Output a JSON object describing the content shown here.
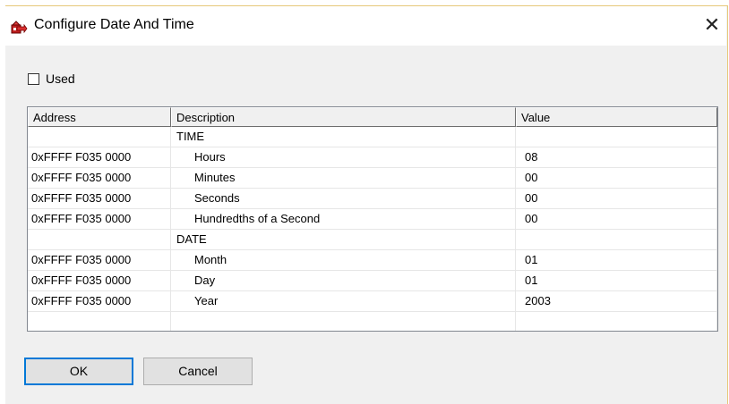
{
  "window": {
    "title": "Configure Date And Time",
    "close_glyph": "✕",
    "icon": "config-icon"
  },
  "used": {
    "label": "Used",
    "checked": false
  },
  "table": {
    "headers": [
      "Address",
      "Description",
      "Value"
    ],
    "rows": [
      {
        "address": "",
        "description": "TIME",
        "value": "",
        "indent": false
      },
      {
        "address": "0xFFFF F035 0000",
        "description": "Hours",
        "value": "08",
        "indent": true
      },
      {
        "address": "0xFFFF F035 0000",
        "description": "Minutes",
        "value": "00",
        "indent": true
      },
      {
        "address": "0xFFFF F035 0000",
        "description": "Seconds",
        "value": "00",
        "indent": true
      },
      {
        "address": "0xFFFF F035 0000",
        "description": "Hundredths of a Second",
        "value": "00",
        "indent": true
      },
      {
        "address": "",
        "description": "DATE",
        "value": "",
        "indent": false
      },
      {
        "address": "0xFFFF F035 0000",
        "description": "Month",
        "value": "01",
        "indent": true
      },
      {
        "address": "0xFFFF F035 0000",
        "description": "Day",
        "value": "01",
        "indent": true
      },
      {
        "address": "0xFFFF F035 0000",
        "description": "Year",
        "value": "2003",
        "indent": true
      },
      {
        "address": "",
        "description": "",
        "value": "",
        "indent": false
      }
    ]
  },
  "buttons": {
    "ok": "OK",
    "cancel": "Cancel"
  },
  "colors": {
    "window_bg": "#f0f0f0",
    "accent_border": "#0078d7",
    "title_border": "#e6c879"
  }
}
